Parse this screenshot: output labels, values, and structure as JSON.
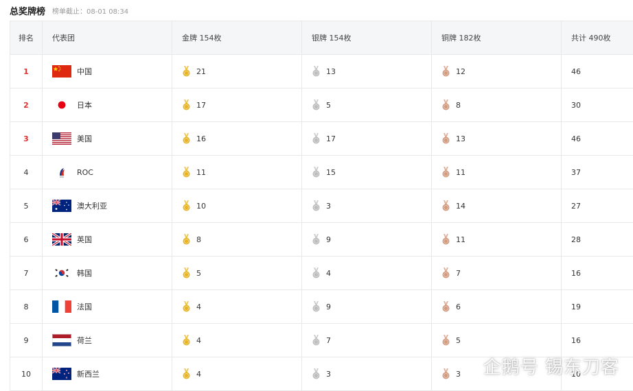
{
  "header": {
    "title": "总奖牌榜",
    "update": "榜单截止：08-01 08:34"
  },
  "columns": {
    "rank": "排名",
    "country": "代表团",
    "gold": "金牌 154枚",
    "silver": "银牌 154枚",
    "bronze": "铜牌 182枚",
    "total": "共计 490枚"
  },
  "colors": {
    "rank_top": "#e0302e",
    "gold": "#e8b422",
    "silver": "#bdbdbd",
    "bronze": "#d39a7e"
  },
  "rows": [
    {
      "rank": "1",
      "flag": "china-flag-icon",
      "country": "中国",
      "gold": "21",
      "silver": "13",
      "bronze": "12",
      "total": "46"
    },
    {
      "rank": "2",
      "flag": "japan-flag-icon",
      "country": "日本",
      "gold": "17",
      "silver": "5",
      "bronze": "8",
      "total": "30"
    },
    {
      "rank": "3",
      "flag": "usa-flag-icon",
      "country": "美国",
      "gold": "16",
      "silver": "17",
      "bronze": "13",
      "total": "46"
    },
    {
      "rank": "4",
      "flag": "roc-emblem-icon",
      "country": "ROC",
      "gold": "11",
      "silver": "15",
      "bronze": "11",
      "total": "37"
    },
    {
      "rank": "5",
      "flag": "australia-flag-icon",
      "country": "澳大利亚",
      "gold": "10",
      "silver": "3",
      "bronze": "14",
      "total": "27"
    },
    {
      "rank": "6",
      "flag": "uk-flag-icon",
      "country": "英国",
      "gold": "8",
      "silver": "9",
      "bronze": "11",
      "total": "28"
    },
    {
      "rank": "7",
      "flag": "korea-flag-icon",
      "country": "韩国",
      "gold": "5",
      "silver": "4",
      "bronze": "7",
      "total": "16"
    },
    {
      "rank": "8",
      "flag": "france-flag-icon",
      "country": "法国",
      "gold": "4",
      "silver": "9",
      "bronze": "6",
      "total": "19"
    },
    {
      "rank": "9",
      "flag": "netherlands-flag-icon",
      "country": "荷兰",
      "gold": "4",
      "silver": "7",
      "bronze": "5",
      "total": "16"
    },
    {
      "rank": "10",
      "flag": "newzealand-flag-icon",
      "country": "新西兰",
      "gold": "4",
      "silver": "3",
      "bronze": "3",
      "total": "10"
    }
  ],
  "watermark": "企鹅号 锡东刀客"
}
